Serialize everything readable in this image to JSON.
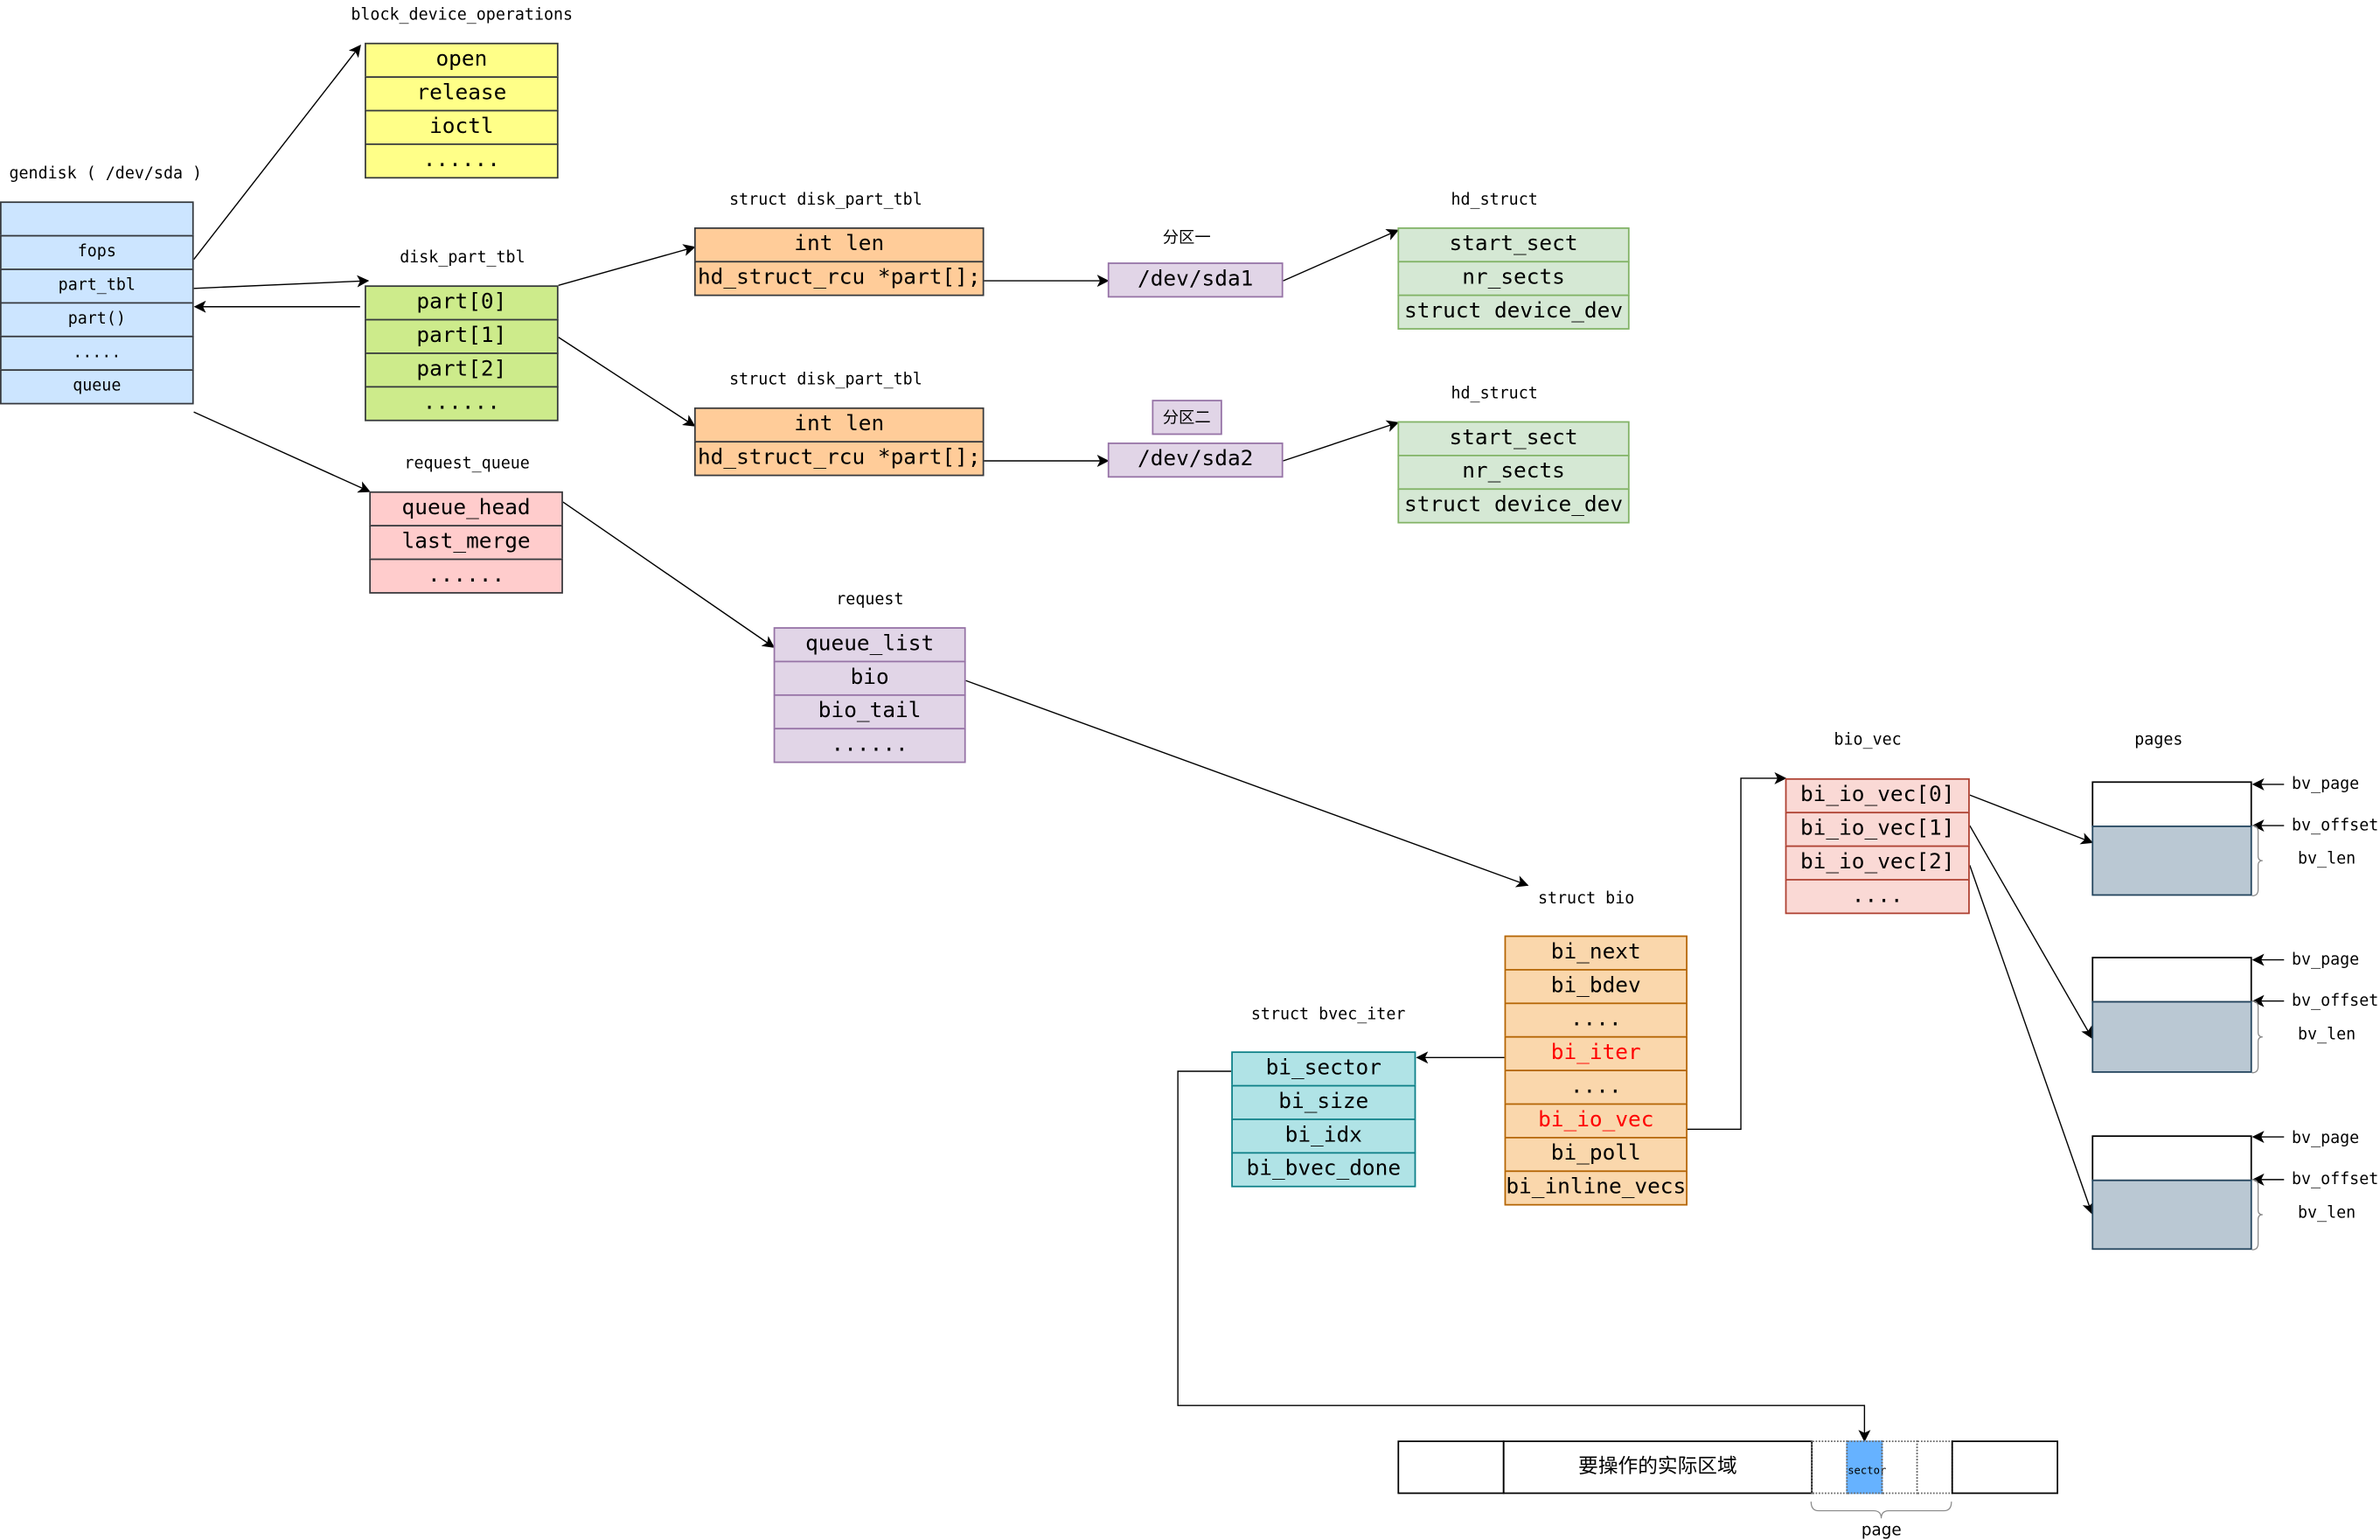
{
  "structs": [
    {
      "id": "gendisk",
      "title": "gendisk ( /dev/sda )",
      "fields": [
        "",
        "fops",
        "part_tbl",
        "part()",
        ".....",
        "queue"
      ],
      "fill": "#cce5ff",
      "stroke": "#36393d"
    },
    {
      "id": "bdops",
      "title": "block_device_operations",
      "fields": [
        "open",
        "release",
        "ioctl",
        "......"
      ],
      "fill": "#ffff88",
      "stroke": "#36393d"
    },
    {
      "id": "dpt",
      "title": "disk_part_tbl",
      "fields": [
        "part[0]",
        "part[1]",
        "part[2]",
        "......"
      ],
      "fill": "#cdeb8b",
      "stroke": "#36393d"
    },
    {
      "id": "rq",
      "title": "request_queue",
      "fields": [
        "queue_head",
        "last_merge",
        "......"
      ],
      "fill": "#ffcccc",
      "stroke": "#36393d"
    },
    {
      "id": "sdpt1",
      "title": "struct disk_part_tbl",
      "fields": [
        "int len",
        "hd_struct_rcu *part[];"
      ],
      "fill": "#ffcc99",
      "stroke": "#36393d"
    },
    {
      "id": "sdpt2",
      "title": "struct disk_part_tbl",
      "fields": [
        "int len",
        "hd_struct_rcu *part[];"
      ],
      "fill": "#ffcc99",
      "stroke": "#36393d"
    },
    {
      "id": "sda1",
      "title": "分区一",
      "fields": [
        "/dev/sda1"
      ],
      "fill": "#e1d5e7",
      "stroke": "#9673a6"
    },
    {
      "id": "sda2",
      "title": "分区二",
      "fields": [
        "/dev/sda2"
      ],
      "fill": "#e1d5e7",
      "stroke": "#9673a6"
    },
    {
      "id": "hd1",
      "title": "hd_struct",
      "fields": [
        "start_sect",
        "nr_sects",
        "struct device_dev"
      ],
      "fill": "#d5e8d4",
      "stroke": "#82b366"
    },
    {
      "id": "hd2",
      "title": "hd_struct",
      "fields": [
        "start_sect",
        "nr_sects",
        "struct device_dev"
      ],
      "fill": "#d5e8d4",
      "stroke": "#82b366"
    },
    {
      "id": "req",
      "title": "request",
      "fields": [
        "queue_list",
        "bio",
        "bio_tail",
        "......"
      ],
      "fill": "#e1d5e7",
      "stroke": "#9673a6"
    },
    {
      "id": "bio",
      "title": "struct bio",
      "fields": [
        "bi_next",
        "bi_bdev",
        "....",
        "bi_iter",
        "....",
        "bi_io_vec",
        "bi_poll",
        "bi_inline_vecs"
      ],
      "highlight": [
        3,
        5
      ],
      "fill": "#fad7ac",
      "stroke": "#b46504"
    },
    {
      "id": "iter",
      "title": "struct bvec_iter",
      "fields": [
        "bi_sector",
        "bi_size",
        "bi_idx",
        "bi_bvec_done"
      ],
      "fill": "#b0e3e6",
      "stroke": "#0e8088"
    },
    {
      "id": "biovec",
      "title": "bio_vec",
      "fields": [
        "bi_io_vec[0]",
        "bi_io_vec[1]",
        "bi_io_vec[2]",
        "...."
      ],
      "fill": "#fad9d5",
      "stroke": "#ae4132"
    }
  ],
  "pages": {
    "title": "pages",
    "labels": [
      "bv_page",
      "bv_offset",
      "bv_len"
    ],
    "fill": "#bac8d3",
    "stroke": "#23445d"
  },
  "disk_strip": {
    "region_label": "要操作的实际区域",
    "sector_label": "sector",
    "page_label": "page",
    "sector_fill": "#66b2ff"
  },
  "colors": {
    "highlight_text": "#ff0000"
  }
}
